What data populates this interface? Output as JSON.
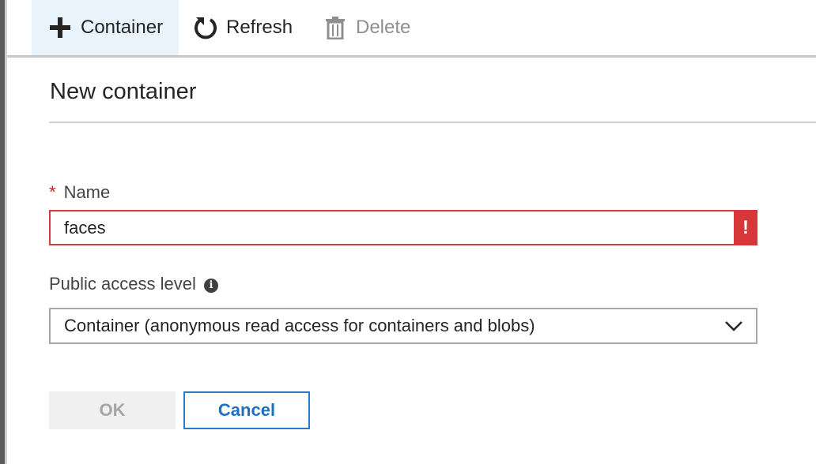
{
  "toolbar": {
    "container_label": "Container",
    "refresh_label": "Refresh",
    "delete_label": "Delete"
  },
  "dialog": {
    "title": "New container",
    "name_field": {
      "required_marker": "*",
      "label": "Name",
      "value": "faces",
      "error_marker": "!"
    },
    "access_field": {
      "label": "Public access level",
      "info_icon": "i",
      "selected": "Container (anonymous read access for containers and blobs)"
    },
    "buttons": {
      "ok": "OK",
      "cancel": "Cancel"
    }
  },
  "colors": {
    "error_red": "#d8373a",
    "link_blue": "#1f70c1",
    "active_tab_bg": "#e8f3fb"
  },
  "icons": {
    "add": "plus-icon",
    "refresh": "refresh-icon",
    "delete": "trash-icon",
    "info": "info-icon",
    "dropdown": "chevron-down-icon",
    "error": "error-icon"
  }
}
